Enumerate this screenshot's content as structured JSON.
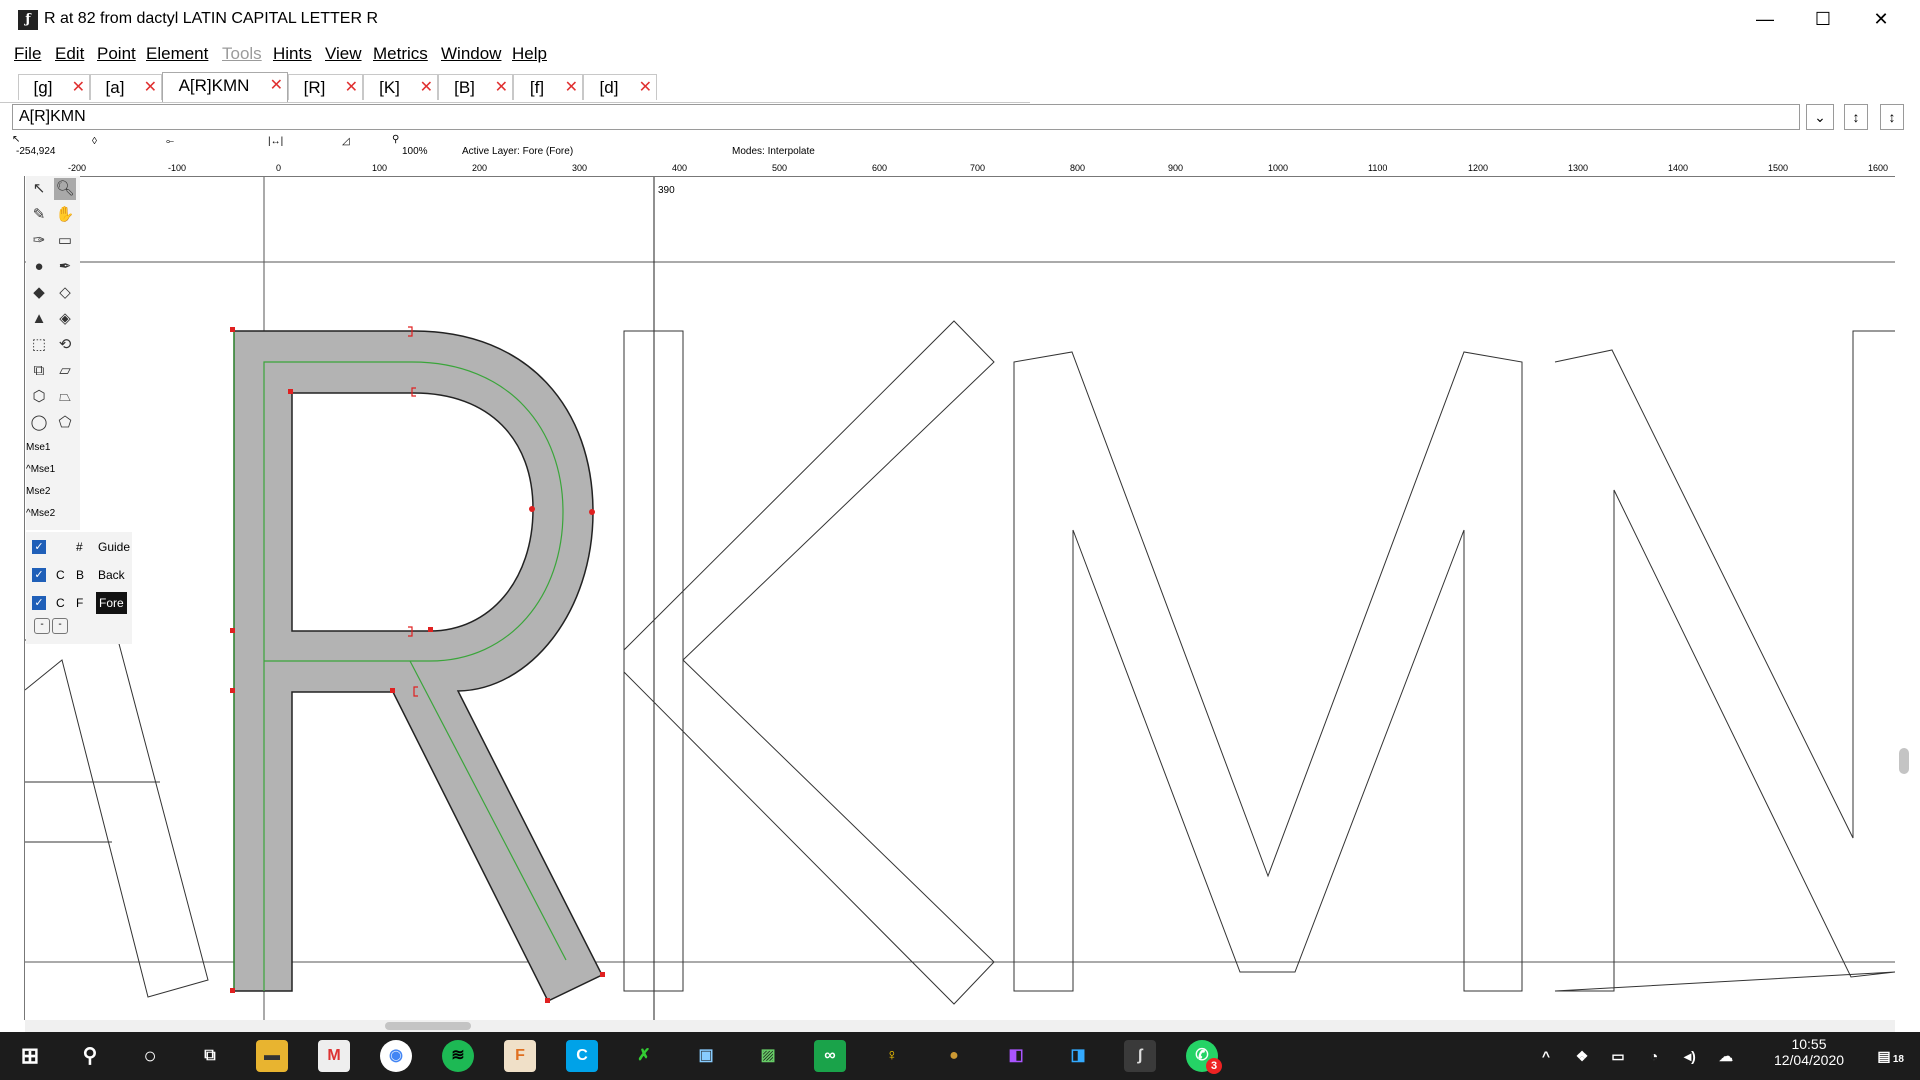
{
  "window": {
    "title": "R at 82 from dactyl LATIN CAPITAL LETTER R",
    "app_icon": "fontforge-icon",
    "controls": {
      "minimize": "—",
      "maximize": "☐",
      "close": "✕"
    }
  },
  "menu": [
    "File",
    "Edit",
    "Point",
    "Element",
    "Tools",
    "Hints",
    "View",
    "Metrics",
    "Window",
    "Help"
  ],
  "tabs": [
    "[g]",
    "[a]",
    "A[R]KMN",
    "[R]",
    "[K]",
    "[B]",
    "[f]",
    "[d]"
  ],
  "active_tab": "A[R]KMN",
  "text_field": {
    "value": "A[R]KMN"
  },
  "infobar": {
    "coords": "-254,924",
    "zoom": "100%",
    "active_layer": "Active Layer: Fore (Fore)",
    "modes": "Modes: Interpolate"
  },
  "ruler": {
    "ticks": [
      "-200",
      "-100",
      "0",
      "100",
      "200",
      "300",
      "400",
      "500",
      "600",
      "700",
      "800",
      "900",
      "1000",
      "1100",
      "1200",
      "1300",
      "1400",
      "1500",
      "1600"
    ],
    "cursor_value": "390"
  },
  "toolbox": {
    "mouse_labels": [
      "Mse1",
      "^Mse1",
      "Mse2",
      "^Mse2"
    ]
  },
  "layers": [
    {
      "code1": "",
      "code2": "#",
      "name": "Guide",
      "checked": true
    },
    {
      "code1": "C",
      "code2": "B",
      "name": "Back",
      "checked": true
    },
    {
      "code1": "C",
      "code2": "F",
      "name": "Fore",
      "checked": true,
      "selected": true
    }
  ],
  "taskbar": {
    "time": "10:55",
    "date": "12/04/2020",
    "notification_count": "18",
    "whatsapp_badge": "3"
  }
}
